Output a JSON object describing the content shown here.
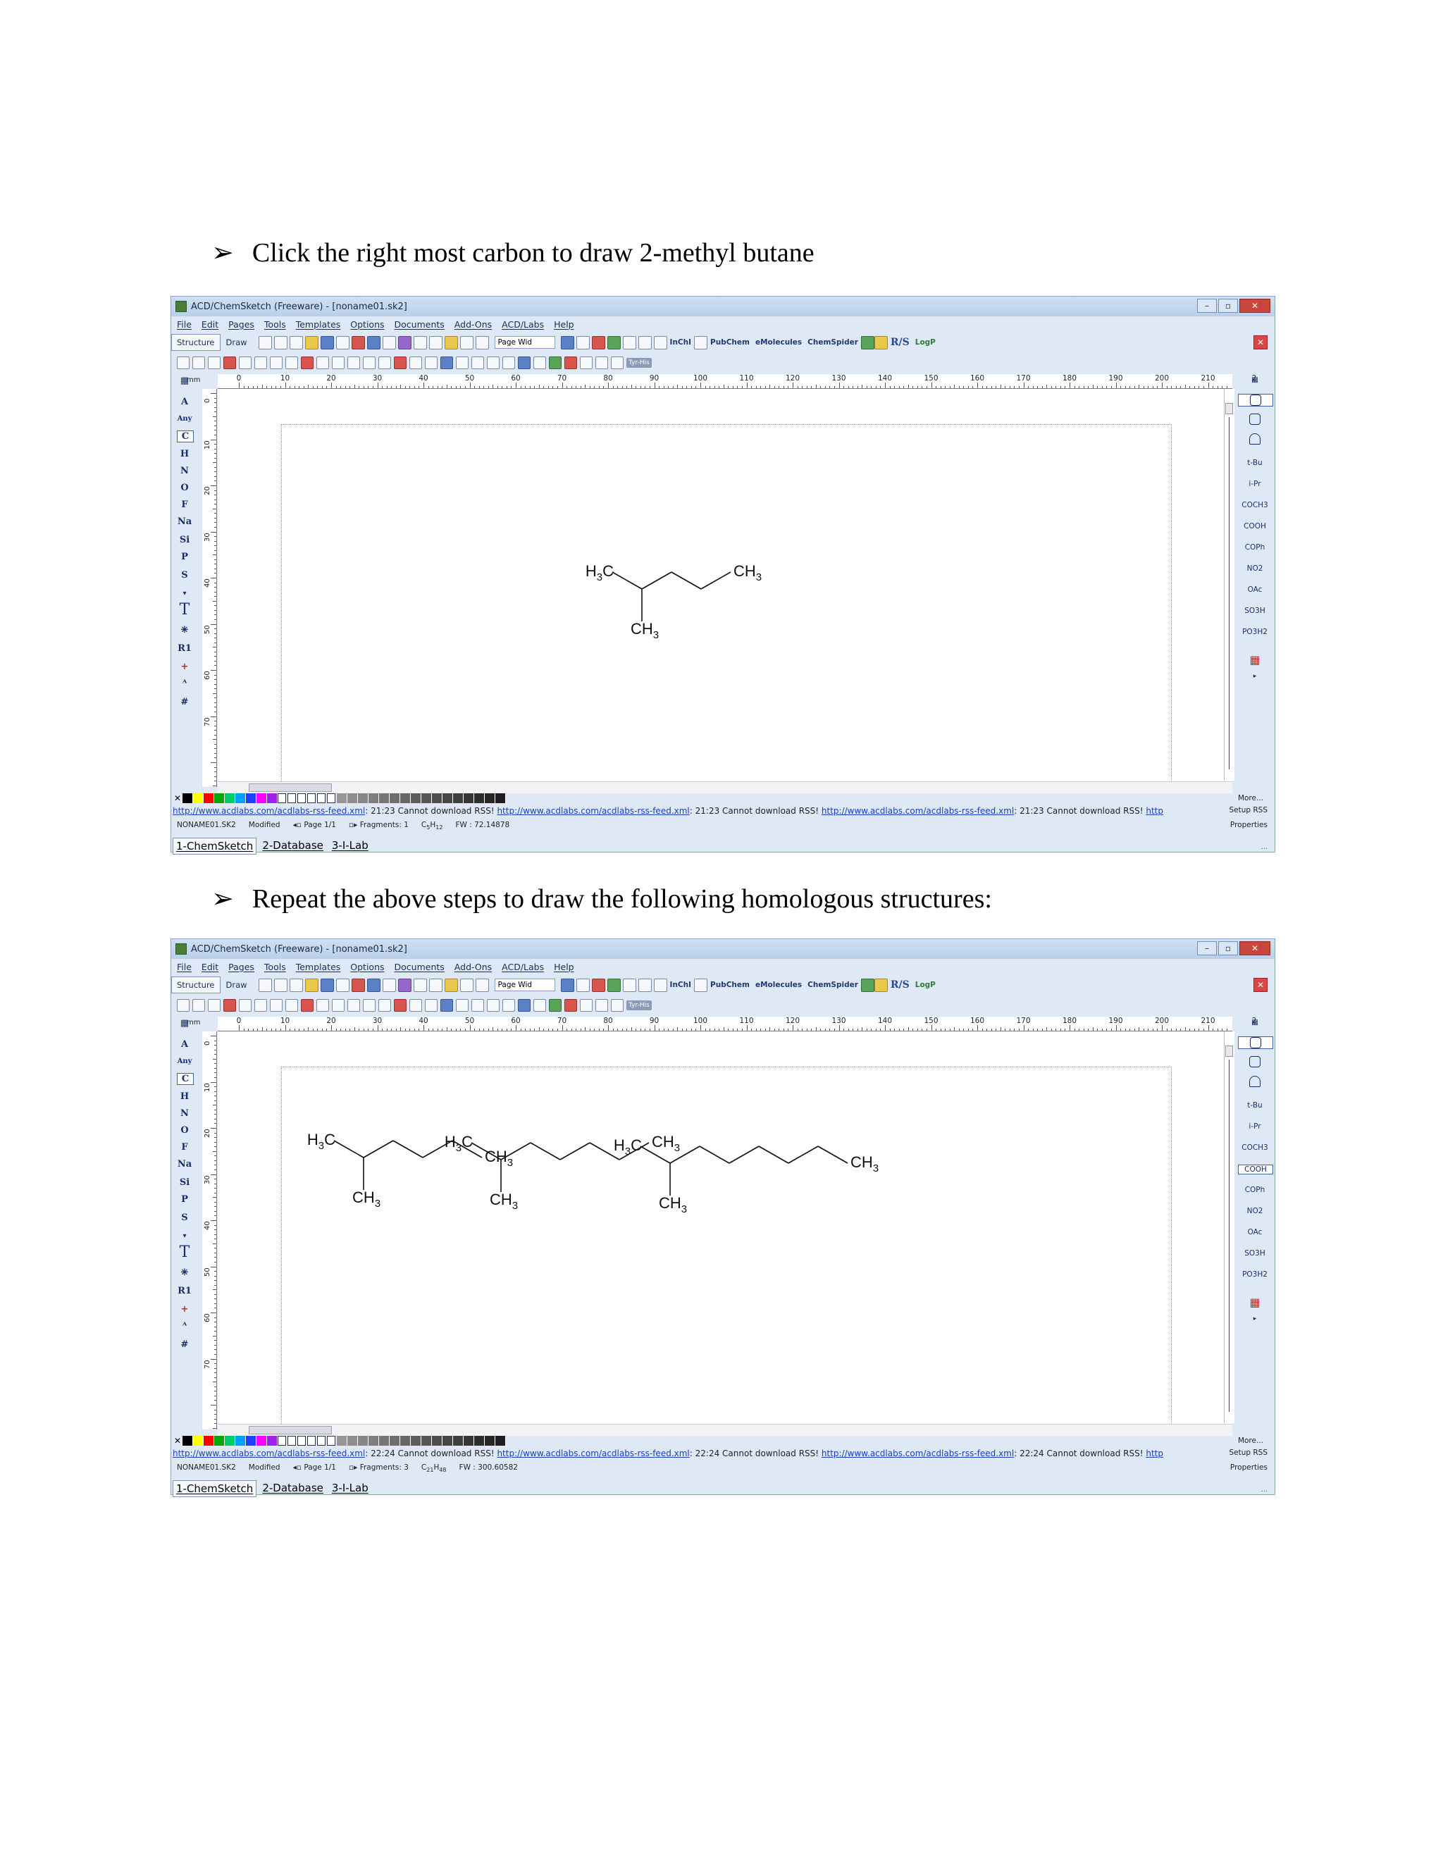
{
  "steps": [
    {
      "bullet": "➢",
      "text": "Click the right most carbon to draw 2-methyl butane"
    },
    {
      "bullet": "➢",
      "text": "Repeat the above steps to draw the following homologous structures:"
    }
  ],
  "app": {
    "title": "ACD/ChemSketch (Freeware) - [noname01.sk2]",
    "menu": [
      "File",
      "Edit",
      "Pages",
      "Tools",
      "Templates",
      "Options",
      "Documents",
      "Add-Ons",
      "ACD/Labs",
      "Help"
    ],
    "mode_structure": "Structure",
    "mode_draw": "Draw",
    "zoom": "Page Wid",
    "toolbar_labels": {
      "inchi": "InChI",
      "pubchem": "PubChem",
      "emolecules": "eMolecules",
      "chemspider": "ChemSpider",
      "rs": "R/S",
      "logp": "LogP",
      "tyrhis": "Tyr-His"
    },
    "ruler_unit": "mm",
    "ruler_top": [
      "0",
      "10",
      "20",
      "30",
      "40",
      "50",
      "60",
      "70",
      "80",
      "90",
      "100",
      "110",
      "120",
      "130",
      "140",
      "150",
      "160",
      "170",
      "180",
      "190",
      "200",
      "210",
      "2"
    ],
    "ruler_left": [
      "0",
      "10",
      "20",
      "30",
      "40",
      "50",
      "60",
      "70"
    ],
    "elements": [
      "A",
      "Any",
      "C",
      "H",
      "N",
      "O",
      "F",
      "Na",
      "Si",
      "P",
      "S"
    ],
    "left_tools": [
      "T",
      "R1",
      "+",
      "#"
    ],
    "right_templates": [
      "t-Bu",
      "i-Pr",
      "COCH3",
      "COOH",
      "COPh",
      "NO2",
      "OAc",
      "SO3H",
      "PO3H2"
    ],
    "more_label": "More...",
    "setup_rss": "Setup RSS",
    "properties": "Properties",
    "tabs": [
      "1-ChemSketch",
      "2-Database",
      "3-I-Lab"
    ],
    "rss_url": "http://www.acdlabs.com/acdlabs-rss-feed.xml",
    "rss_msg": "Cannot download RSS!",
    "rss_tail": "http"
  },
  "screens": [
    {
      "rss_time": "21:23",
      "status": {
        "doc": "NONAME01.SK2",
        "modified": "Modified",
        "page": "Page 1/1",
        "fragments": "Fragments: 1",
        "formula": "C5H12",
        "fw": "FW : 72.14878"
      },
      "molecules": [
        {
          "labels": {
            "left": "H3C",
            "right": "CH3",
            "branch": "CH3"
          }
        }
      ]
    },
    {
      "rss_time": "22:24",
      "status": {
        "doc": "NONAME01.SK2",
        "modified": "Modified",
        "page": "Page 1/1",
        "fragments": "Fragments: 3",
        "formula": "C21H48",
        "fw": "FW : 300.60582"
      },
      "molecules": [
        {
          "labels": {
            "left": "H3C",
            "right": "CH3",
            "branch": "CH3"
          }
        },
        {
          "labels": {
            "left": "H3C",
            "right": "CH3",
            "branch": "CH3"
          }
        },
        {
          "labels": {
            "left": "H3C",
            "right": "CH3",
            "branch": "CH3"
          }
        }
      ]
    }
  ]
}
